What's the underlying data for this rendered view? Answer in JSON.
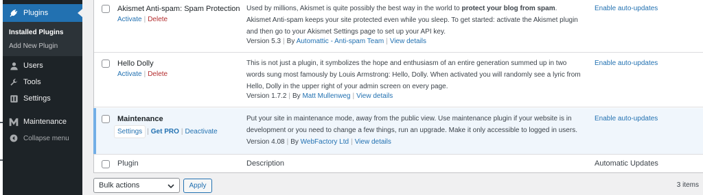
{
  "sidebar": {
    "current": "Plugins",
    "submenu": [
      "Installed Plugins",
      "Add New Plugin"
    ],
    "items": [
      {
        "label": "Users",
        "icon": "users-icon"
      },
      {
        "label": "Tools",
        "icon": "wrench-icon"
      },
      {
        "label": "Settings",
        "icon": "settings-icon"
      },
      {
        "label": "Maintenance",
        "icon": "maintenance-logo-icon"
      },
      {
        "label": "Collapse menu",
        "icon": "collapse-icon"
      }
    ]
  },
  "plugins": [
    {
      "name": "Akismet Anti-spam: Spam Protection",
      "actions": [
        "Activate",
        "Delete"
      ],
      "description_pre": "Used by millions, Akismet is quite possibly the best way in the world to ",
      "description_bold": "protect your blog from spam",
      "description_post": ". Akismet Anti-spam keeps your site protected even while you sleep. To get started: activate the Akismet plugin and then go to your Akismet Settings page to set up your API key.",
      "version": "Version 5.3",
      "by": "By",
      "author": "Automattic - Anti-spam Team",
      "details": "View details",
      "auto_updates": "Enable auto-updates"
    },
    {
      "name": "Hello Dolly",
      "actions": [
        "Activate",
        "Delete"
      ],
      "description": "This is not just a plugin, it symbolizes the hope and enthusiasm of an entire generation summed up in two words sung most famously by Louis Armstrong: Hello, Dolly. When activated you will randomly see a lyric from Hello, Dolly in the upper right of your admin screen on every page.",
      "version": "Version 1.7.2",
      "by": "By",
      "author": "Matt Mullenweg",
      "details": "View details",
      "auto_updates": "Enable auto-updates"
    },
    {
      "name": "Maintenance",
      "actions": [
        "Settings",
        "Get PRO",
        "Deactivate"
      ],
      "description": "Put your site in maintenance mode, away from the public view. Use maintenance plugin if your website is in development or you need to change a few things, run an upgrade. Make it only accessible to logged in users.",
      "version": "Version 4.08",
      "by": "By",
      "author": "WebFactory Ltd",
      "details": "View details",
      "auto_updates": "Enable auto-updates"
    }
  ],
  "footer": {
    "col_plugin": "Plugin",
    "col_description": "Description",
    "col_auto_updates": "Automatic Updates"
  },
  "bulk_actions": {
    "selected": "Bulk actions",
    "apply": "Apply"
  },
  "item_count": "3 items",
  "colors": {
    "accent": "#2271b1",
    "sidebar": "#1d2327",
    "delete": "#b32d2e"
  }
}
